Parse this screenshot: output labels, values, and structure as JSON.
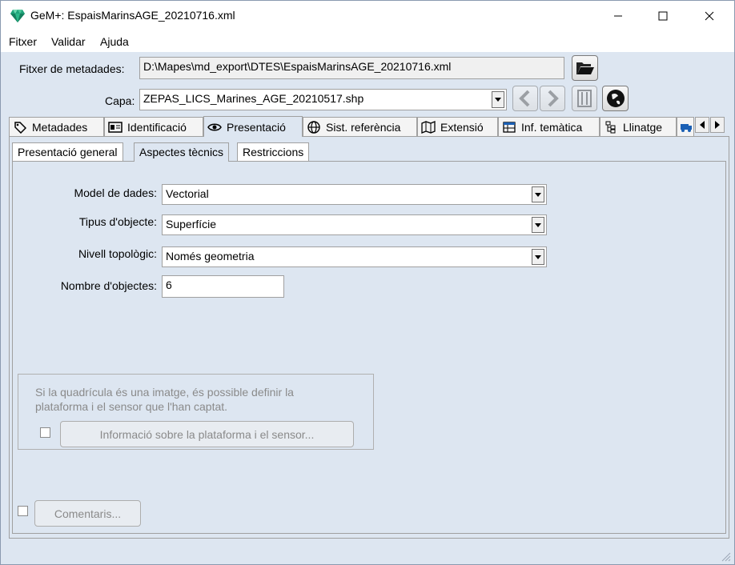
{
  "window": {
    "title": "GeM+: EspaisMarinsAGE_20210716.xml",
    "app_icon": "diamond-icon",
    "controls": [
      "minimize-icon",
      "maximize-icon",
      "close-icon"
    ]
  },
  "menu": [
    {
      "label": "Fitxer"
    },
    {
      "label": "Validar"
    },
    {
      "label": "Ajuda"
    }
  ],
  "file": {
    "label": "Fitxer de metadades:",
    "value": "D:\\Mapes\\md_export\\DTES\\EspaisMarinsAGE_20210716.xml",
    "open_icon": "folder-open-icon"
  },
  "layer": {
    "label": "Capa:",
    "value": "ZEPAS_LICS_Marines_AGE_20210517.shp",
    "buttons": [
      "prev-icon",
      "next-icon",
      "metadata-book-icon",
      "globe-link-icon"
    ]
  },
  "tabs": [
    {
      "label": "Metadades",
      "icon": "tag-icon"
    },
    {
      "label": "Identificació",
      "icon": "id-card-icon"
    },
    {
      "label": "Presentació",
      "icon": "eye-icon",
      "active": true
    },
    {
      "label": "Sist. referència",
      "icon": "globe-icon"
    },
    {
      "label": "Extensió",
      "icon": "map-icon"
    },
    {
      "label": "Inf. temàtica",
      "icon": "table-icon"
    },
    {
      "label": "Llinatge",
      "icon": "tree-icon"
    },
    {
      "label": "",
      "icon": "truck-icon"
    }
  ],
  "subtabs": [
    {
      "label": "Presentació general"
    },
    {
      "label": "Aspectes tècnics",
      "active": true
    },
    {
      "label": "Restriccions"
    }
  ],
  "form": {
    "data_model": {
      "label": "Model de dades:",
      "value": "Vectorial"
    },
    "object_type": {
      "label": "Tipus d'objecte:",
      "value": "Superfície"
    },
    "topology": {
      "label": "Nivell topològic:",
      "value": "Només geometria"
    },
    "object_count": {
      "label": "Nombre d'objectes:",
      "value": "6"
    }
  },
  "sensor_group": {
    "text_line1": "Si la quadrícula és una imatge, és possible definir la",
    "text_line2": "plataforma i el sensor que l'han captat.",
    "button": "Informació sobre la plataforma i el sensor...",
    "checked": false
  },
  "comments": {
    "button": "Comentaris...",
    "checked": false
  }
}
